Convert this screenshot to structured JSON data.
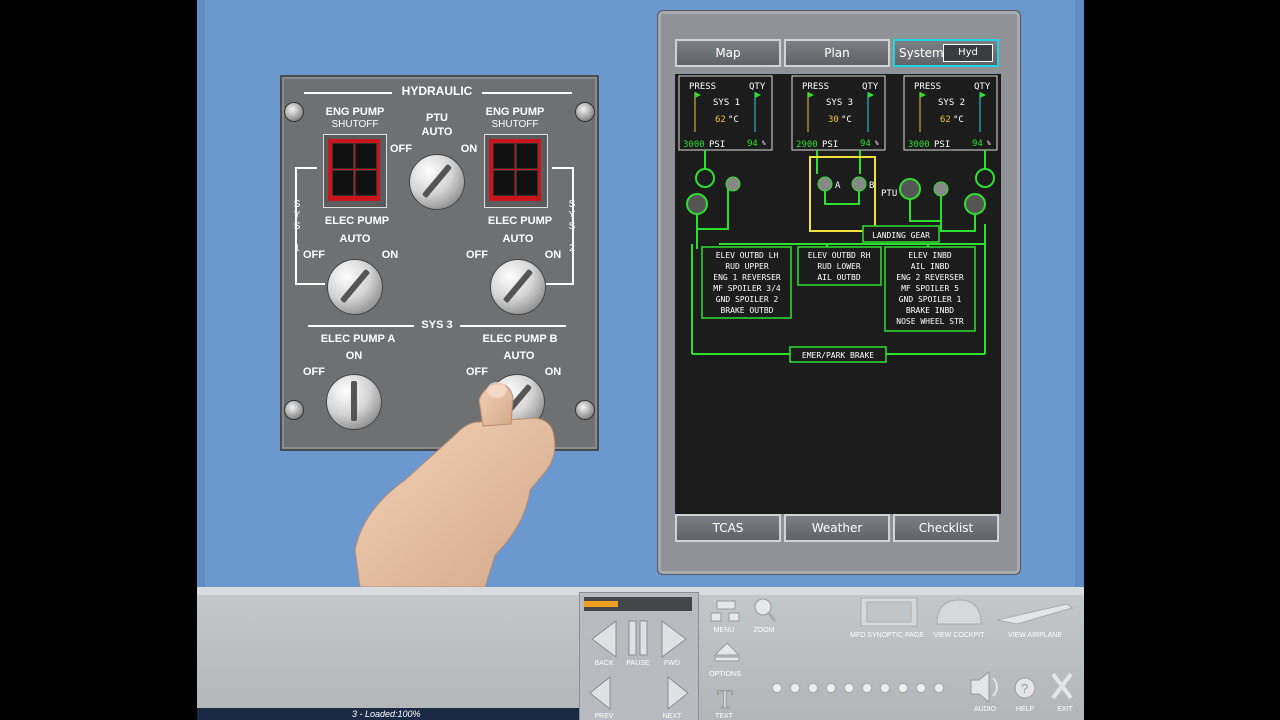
{
  "hydraulic_panel": {
    "title": "HYDRAULIC",
    "eng_pump_1": {
      "line1": "ENG PUMP",
      "line2": "SHUTOFF"
    },
    "eng_pump_2": {
      "line1": "ENG PUMP",
      "line2": "SHUTOFF"
    },
    "ptu": {
      "label": "PTU",
      "center": "AUTO",
      "left": "OFF",
      "right": "ON"
    },
    "sys1_label": [
      "S",
      "Y",
      "S",
      "1"
    ],
    "sys2_label": [
      "S",
      "Y",
      "S",
      "2"
    ],
    "elec_pump_1": {
      "label": "ELEC PUMP",
      "center": "AUTO",
      "left": "OFF",
      "right": "ON"
    },
    "elec_pump_2": {
      "label": "ELEC PUMP",
      "center": "AUTO",
      "left": "OFF",
      "right": "ON"
    },
    "sys3_label": "SYS 3",
    "elec_pump_a": {
      "label": "ELEC PUMP A",
      "center": "ON",
      "left": "OFF"
    },
    "elec_pump_b": {
      "label": "ELEC PUMP B",
      "center": "AUTO",
      "left": "OFF",
      "right": "ON"
    }
  },
  "mfd": {
    "top_buttons": [
      "Map",
      "Plan",
      "Systems"
    ],
    "systems_sub": "Hyd",
    "bottom_buttons": [
      "TCAS",
      "Weather",
      "Checklist"
    ],
    "highlight_color": "#22d3e0",
    "synoptic": {
      "systems": [
        {
          "name": "SYS 1",
          "press_label": "PRESS",
          "qty_label": "QTY",
          "temp": "62",
          "temp_unit": "°C",
          "psi": "3000",
          "psi_unit": "PSI",
          "qty": "94",
          "qty_unit": "%"
        },
        {
          "name": "SYS 3",
          "press_label": "PRESS",
          "qty_label": "QTY",
          "temp": "30",
          "temp_unit": "°C",
          "psi": "2900",
          "psi_unit": "PSI",
          "qty": "94",
          "qty_unit": "%"
        },
        {
          "name": "SYS 2",
          "press_label": "PRESS",
          "qty_label": "QTY",
          "temp": "62",
          "temp_unit": "°C",
          "psi": "3000",
          "psi_unit": "PSI",
          "qty": "94",
          "qty_unit": "%"
        }
      ],
      "pump_labels": {
        "a": "A",
        "b": "B",
        "ptu": "PTU"
      },
      "landing_gear": "LANDING GEAR",
      "box_left": [
        "ELEV OUTBD LH",
        "RUD UPPER",
        "ENG 1 REVERSER",
        "MF SPOILER 3/4",
        "GND SPOILER 2",
        "BRAKE OUTBD"
      ],
      "box_mid": [
        "ELEV OUTBD RH",
        "RUD LOWER",
        "AIL OUTBD"
      ],
      "box_right": [
        "ELEV INBD",
        "AIL INBD",
        "ENG 2 REVERSER",
        "MF SPOILER 5",
        "GND SPOILER 1",
        "BRAKE INBD",
        "NOSE WHEEL STR"
      ],
      "emer_brake": "EMER/PARK BRAKE",
      "line_color": "#2ee02e",
      "highlight_box_color": "#f0e040"
    }
  },
  "controls": {
    "nav": {
      "back": "BACK",
      "pause": "PAUSE",
      "fwd": "FWD",
      "prev": "PREV",
      "next": "NEXT"
    },
    "menu": "MENU",
    "zoom": "ZOOM",
    "options": "OPTIONS",
    "text": "TEXT",
    "mfd_synoptic": "MFD SYNOPTIC PAGE",
    "view_cockpit": "VIEW COCKPIT",
    "view_airplane": "VIEW AIRPLANE",
    "audio": "AUDIO",
    "help": "HELP",
    "exit": "EXIT",
    "status": "3 - Loaded:100%",
    "progress_color": "#f0a020"
  }
}
